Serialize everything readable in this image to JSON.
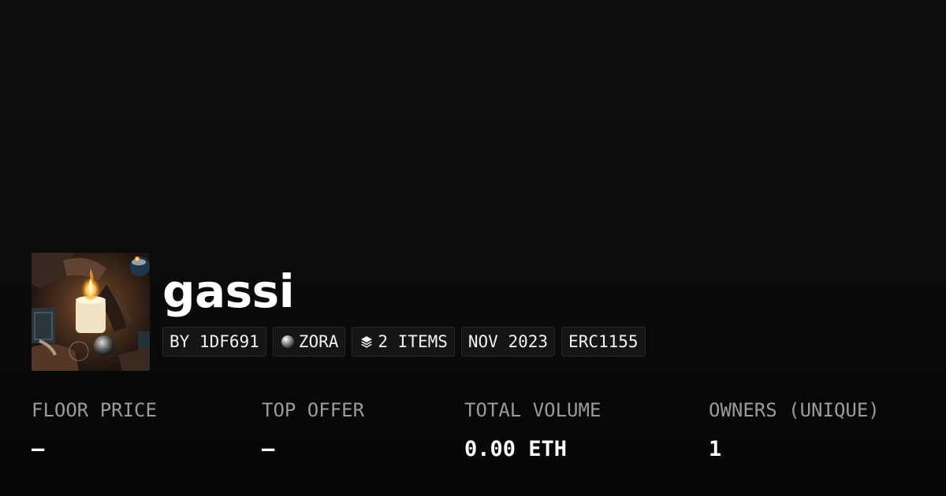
{
  "collection": {
    "name": "gassi",
    "cover_image": "candle-ritual-artwork"
  },
  "badges": {
    "creator": "BY 1DF691",
    "chain": "ZORA",
    "chain_icon": "zora-orb-icon",
    "items": "2 ITEMS",
    "items_icon": "layers-icon",
    "date": "NOV 2023",
    "standard": "ERC1155"
  },
  "stats": [
    {
      "label": "FLOOR PRICE",
      "value": "–"
    },
    {
      "label": "TOP OFFER",
      "value": "–"
    },
    {
      "label": "TOTAL VOLUME",
      "value": "0.00 ETH"
    },
    {
      "label": "OWNERS (UNIQUE)",
      "value": "1"
    }
  ],
  "colors": {
    "background": "#0b0b0b",
    "text": "#ffffff",
    "muted": "#9b9b9b",
    "badge_bg": "#151515",
    "badge_border": "#262626"
  }
}
